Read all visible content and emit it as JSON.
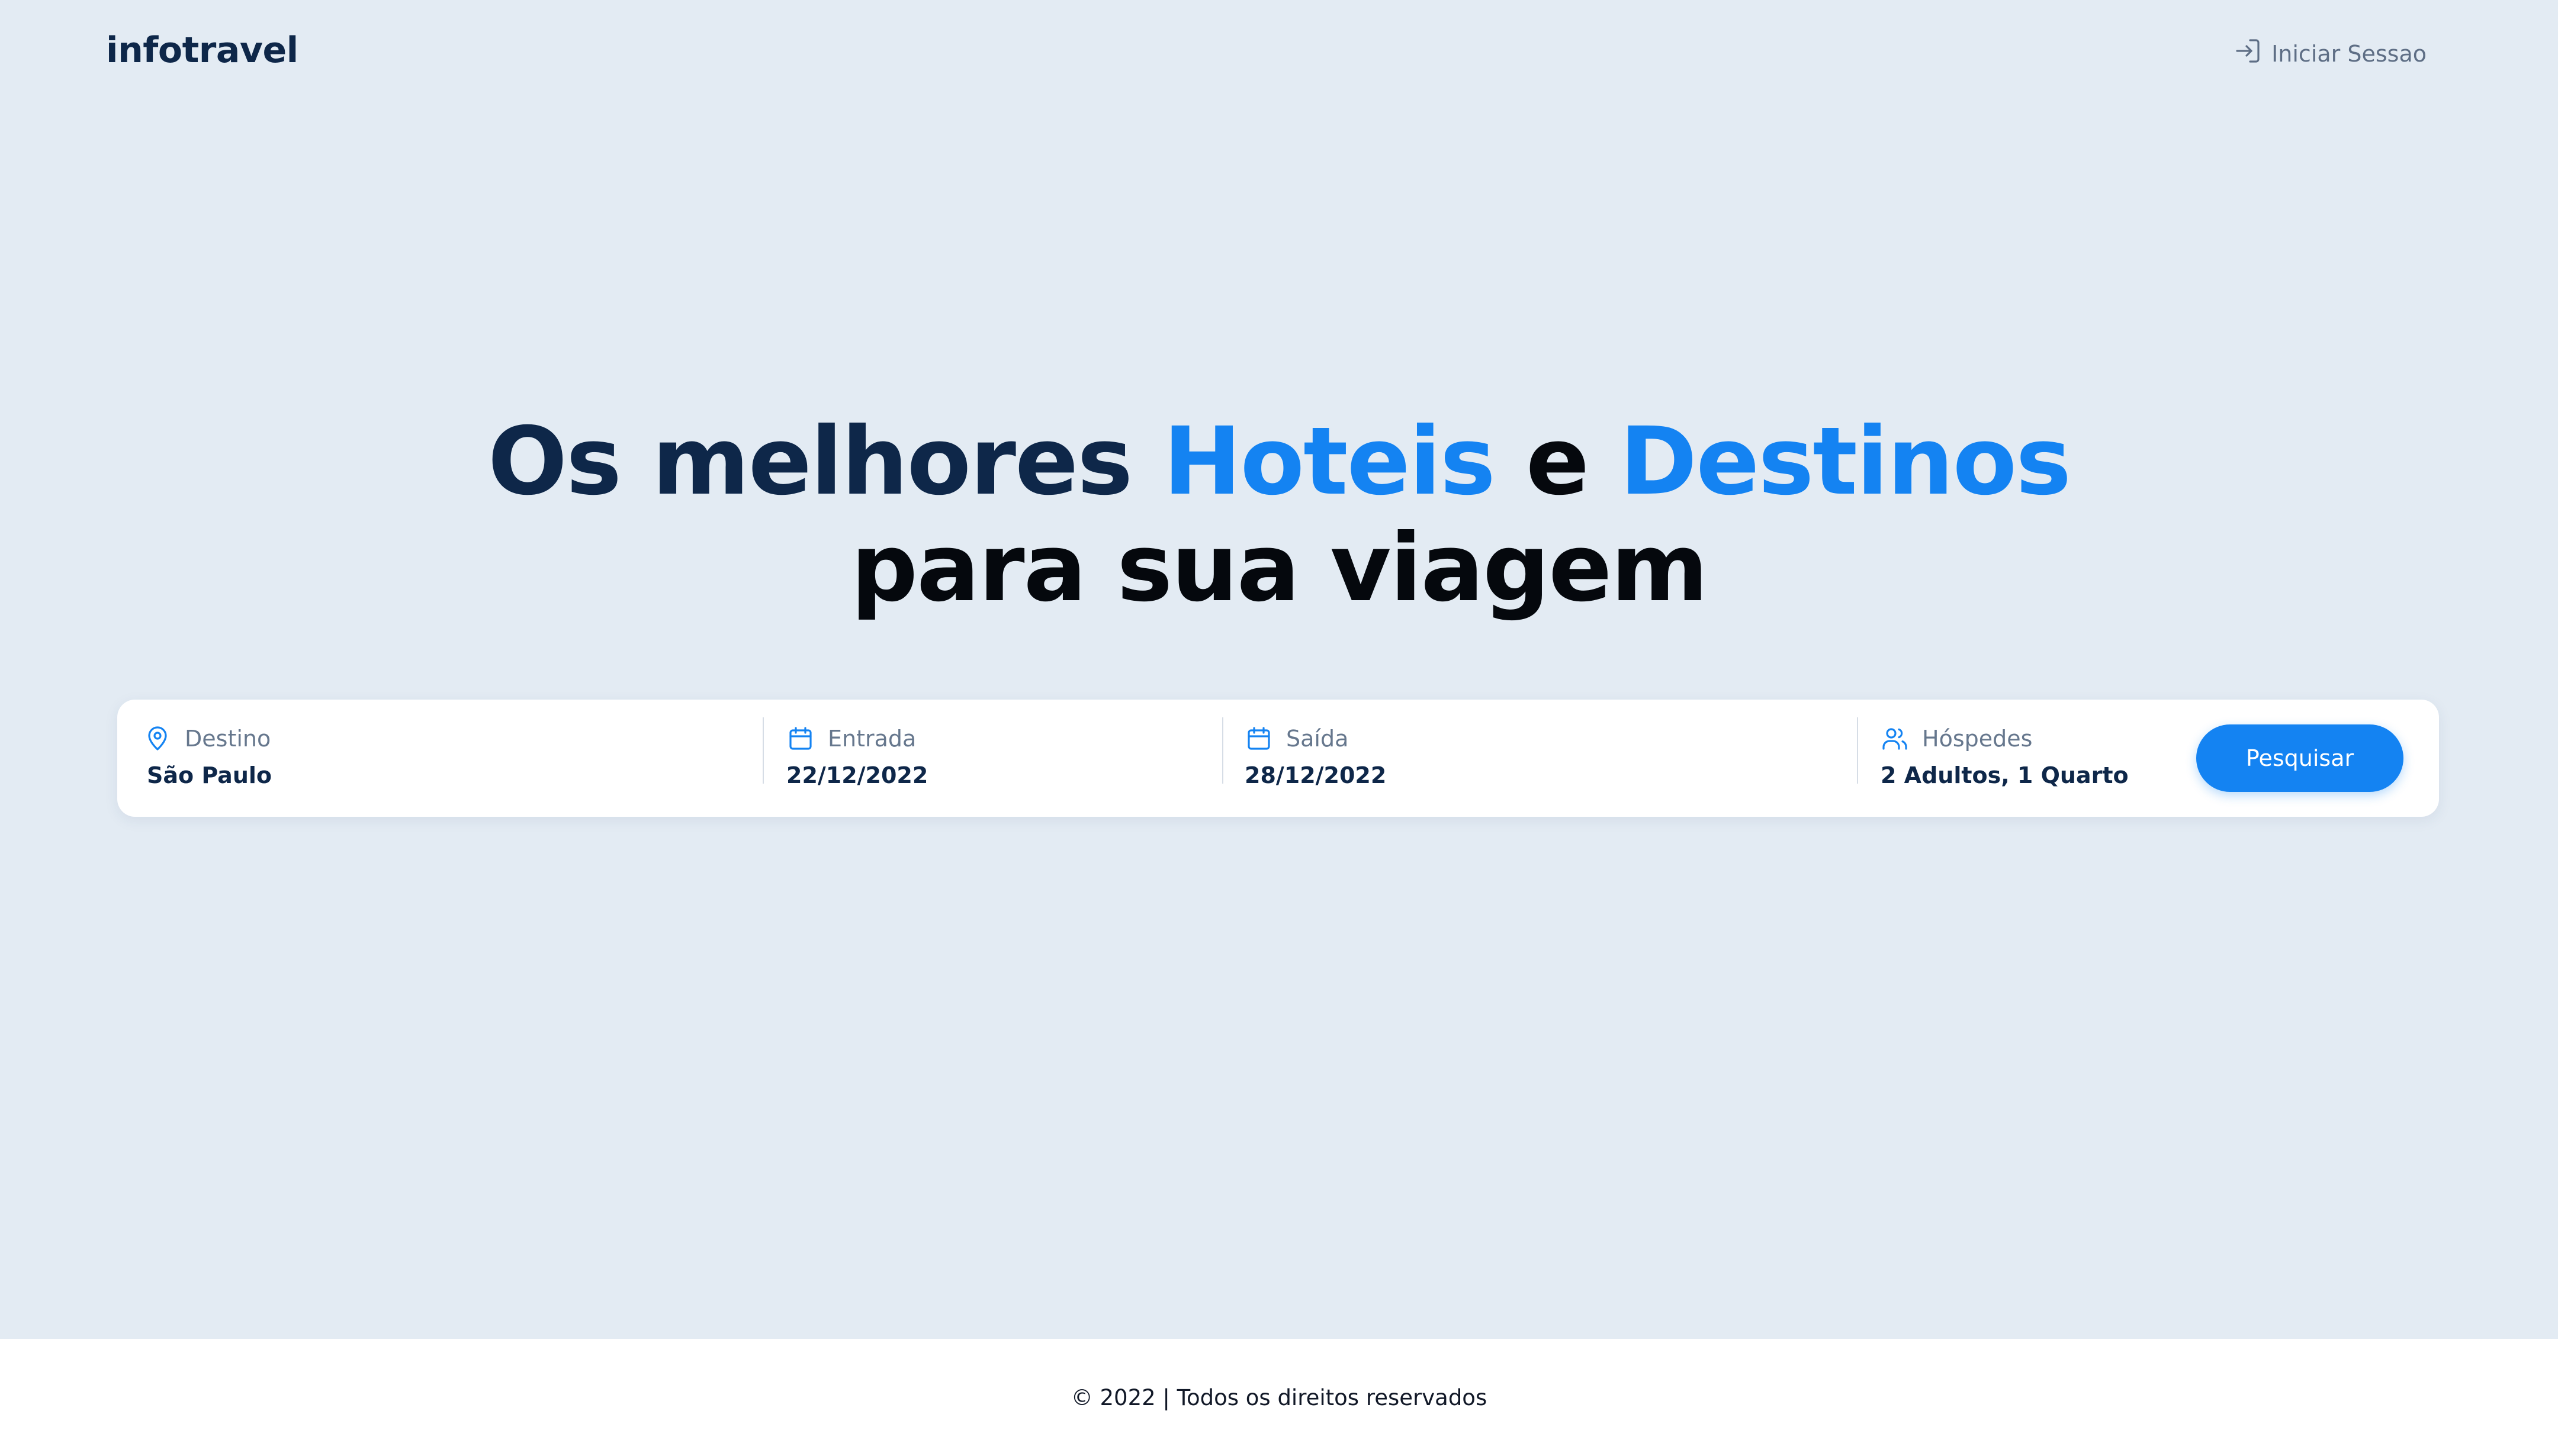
{
  "header": {
    "logo": "infotravel",
    "signin_label": "Iniciar Sessao"
  },
  "hero": {
    "line1_part1": "Os melhores ",
    "line1_highlight1": "Hoteis",
    "line1_connector": " e ",
    "line1_highlight2": "Destinos",
    "line2": "para sua viagem"
  },
  "search": {
    "destination": {
      "label": "Destino",
      "value": "São Paulo",
      "icon": "map-pin-icon"
    },
    "checkin": {
      "label": "Entrada",
      "value": "22/12/2022",
      "icon": "calendar-icon"
    },
    "checkout": {
      "label": "Saída",
      "value": "28/12/2022",
      "icon": "calendar-icon"
    },
    "guests": {
      "label": "Hóspedes",
      "value": "2 Adultos, 1 Quarto",
      "icon": "users-icon"
    },
    "button_label": "Pesquisar"
  },
  "footer": {
    "text": "© 2022 | Todos os direitos reservados"
  },
  "colors": {
    "background": "#e3ebf3",
    "primary": "#1483f2",
    "navy": "#0e2749",
    "muted": "#66778d"
  }
}
